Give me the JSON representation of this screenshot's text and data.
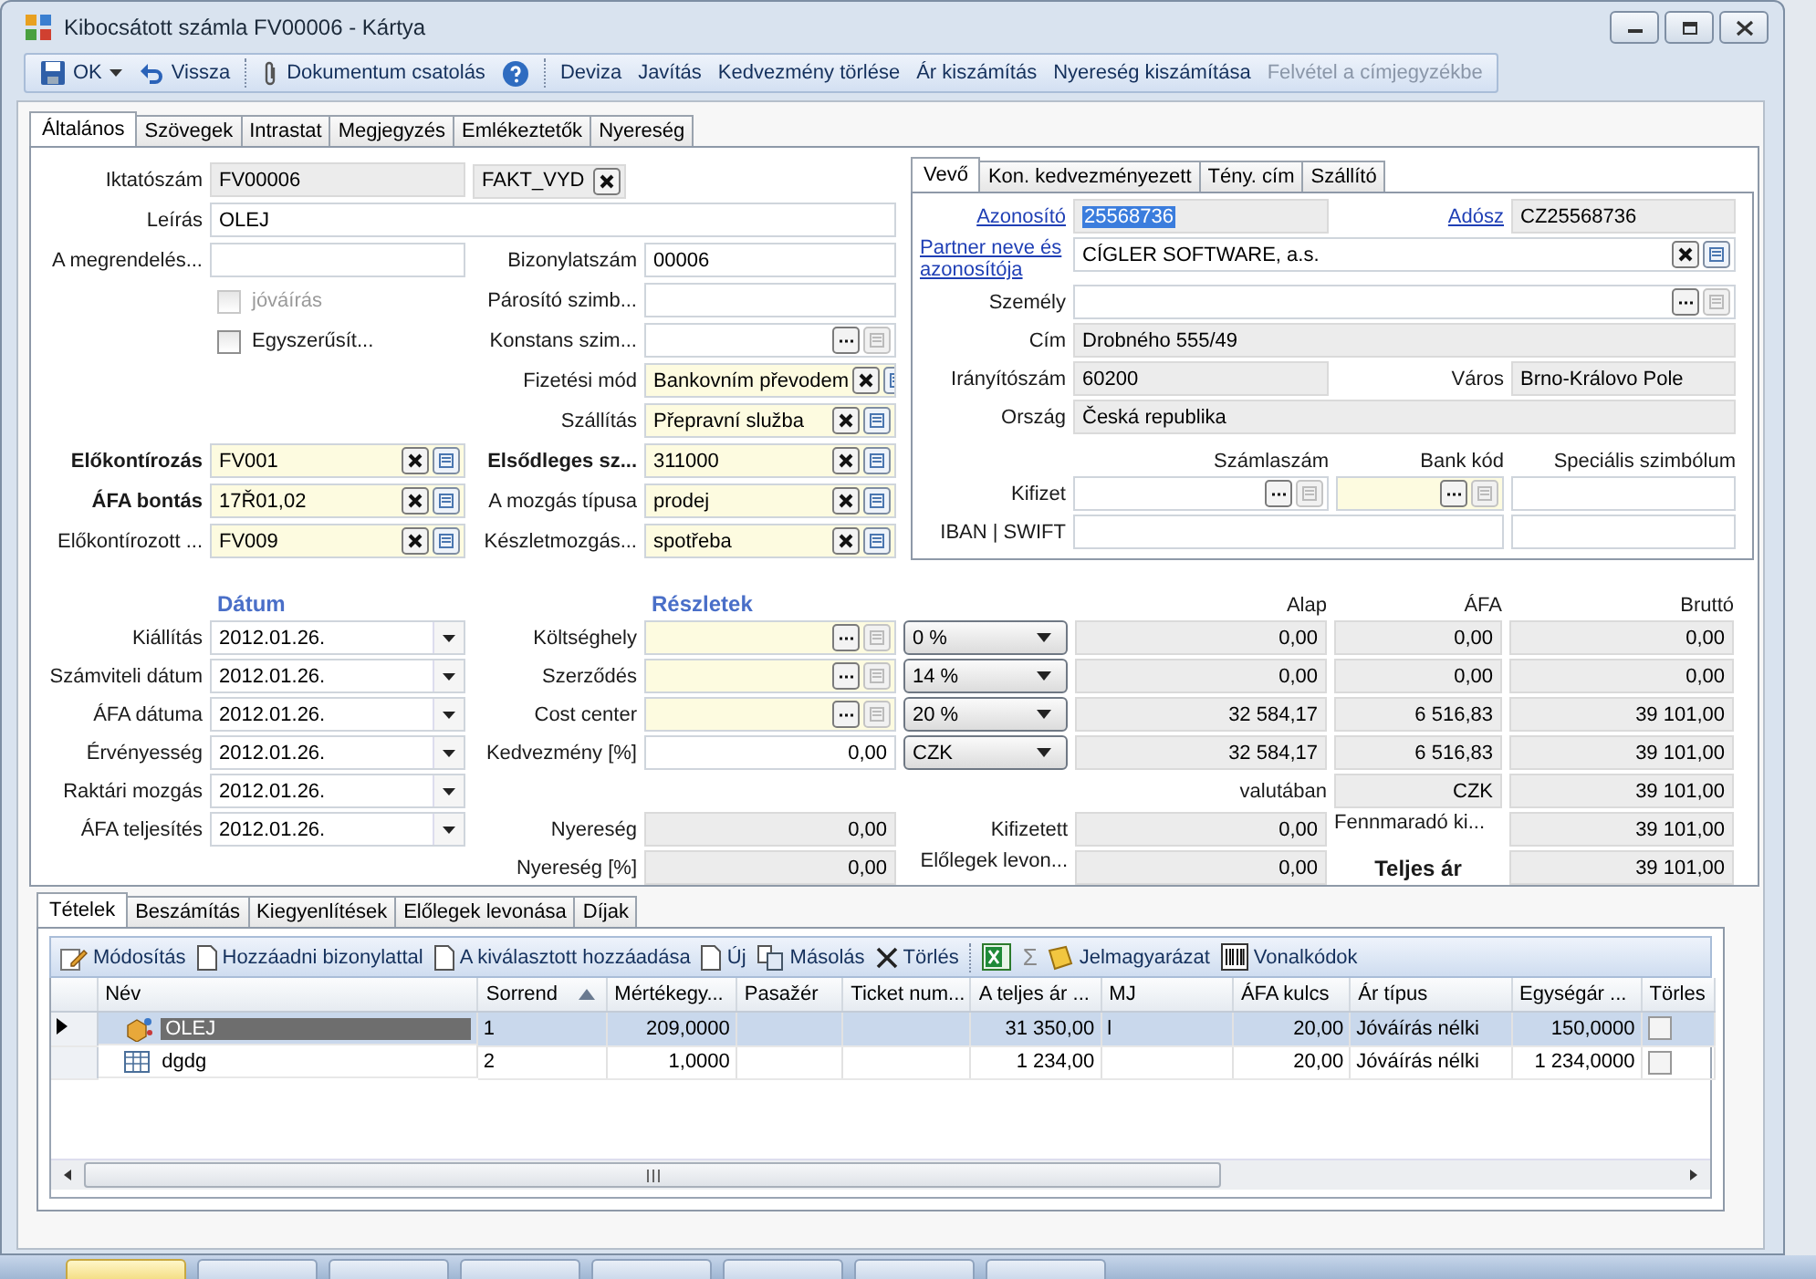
{
  "window": {
    "title": "Kibocsátott számla FV00006 - Kártya"
  },
  "toolbar": [
    {
      "label": "OK",
      "kind": "save",
      "disabled": false
    },
    {
      "label": "Vissza",
      "kind": "undo",
      "disabled": false
    },
    {
      "kind": "separator"
    },
    {
      "label": "Dokumentum csatolás",
      "kind": "attach",
      "disabled": false
    },
    {
      "kind": "help"
    },
    {
      "kind": "separator"
    },
    {
      "label": "Deviza",
      "kind": "text",
      "disabled": false
    },
    {
      "label": "Javítás",
      "kind": "text",
      "disabled": false
    },
    {
      "label": "Kedvezmény törlése",
      "kind": "text",
      "disabled": false
    },
    {
      "label": "Ár kiszámítás",
      "kind": "text",
      "disabled": false
    },
    {
      "label": "Nyereség kiszámítása",
      "kind": "text",
      "disabled": false
    },
    {
      "label": "Felvétel a címjegyzékbe",
      "kind": "text",
      "disabled": true
    }
  ],
  "tabs": [
    {
      "label": "Általános",
      "selected": true
    },
    {
      "label": "Szövegek",
      "selected": false
    },
    {
      "label": "Intrastat",
      "selected": false
    },
    {
      "label": "Megjegyzés",
      "selected": false
    },
    {
      "label": "Emlékeztetők",
      "selected": false
    },
    {
      "label": "Nyereség",
      "selected": false
    }
  ],
  "general": {
    "rows": [
      {
        "kind": "split",
        "label": "Iktatószám",
        "bold": false,
        "fields": [
          {
            "kind": "readonly",
            "value": "FV00006"
          },
          {
            "kind": "code",
            "value": "FAKT_VYD"
          }
        ]
      },
      {
        "kind": "wide",
        "label": "Leírás",
        "bold": false,
        "fields": [
          {
            "kind": "text",
            "value": "OLEJ",
            "required": false
          }
        ]
      },
      {
        "kind": "pair",
        "label": "A megrendelés...",
        "bold": false,
        "fields": [
          {
            "kind": "text",
            "required": false
          }
        ],
        "right": {
          "label": "Bizonylatszám",
          "bold": false,
          "field": {
            "kind": "text",
            "value": "00006",
            "required": false
          }
        }
      },
      {
        "kind": "pair",
        "fields": [
          {
            "kind": "checkbox",
            "label": "jóváírás",
            "checked": false,
            "disabled": true
          }
        ],
        "right": {
          "label": "Párosító szimb...",
          "bold": false,
          "field": {
            "kind": "text",
            "required": false
          }
        }
      },
      {
        "kind": "pair",
        "fields": [
          {
            "kind": "checkbox",
            "label": "Egyszerűsít...",
            "checked": false,
            "disabled": false
          }
        ],
        "right": {
          "label": "Konstans szim...",
          "bold": false,
          "field": {
            "kind": "picker",
            "required": false
          }
        }
      },
      {
        "kind": "pair",
        "right": {
          "label": "Fizetési mód",
          "bold": false,
          "field": {
            "kind": "lookup",
            "value": "Bankovním převodem",
            "required": true
          }
        }
      },
      {
        "kind": "pair",
        "right": {
          "label": "Szállítás",
          "bold": false,
          "field": {
            "kind": "lookup",
            "value": "Přepravní služba",
            "required": true
          }
        }
      },
      {
        "kind": "pair",
        "label": "Előkontírozás",
        "bold": true,
        "fields": [
          {
            "kind": "lookup",
            "value": "FV001",
            "required": true
          }
        ],
        "right": {
          "label": "Elsődleges sz...",
          "bold": true,
          "field": {
            "kind": "lookup",
            "value": "311000",
            "required": true
          }
        }
      },
      {
        "kind": "pair",
        "label": "ÁFA bontás",
        "bold": true,
        "fields": [
          {
            "kind": "lookup",
            "value": "17Ř01,02",
            "required": true
          }
        ],
        "right": {
          "label": "A mozgás típusa",
          "bold": false,
          "field": {
            "kind": "lookup",
            "value": "prodej",
            "required": true
          }
        }
      },
      {
        "kind": "pair",
        "label": "Előkontírozott ...",
        "bold": false,
        "fields": [
          {
            "kind": "lookup",
            "value": "FV009",
            "required": true
          }
        ],
        "right": {
          "label": "Készletmozgás...",
          "bold": false,
          "field": {
            "kind": "lookup",
            "value": "spotřeba",
            "required": true
          }
        }
      }
    ]
  },
  "partner": {
    "tabs": [
      {
        "label": "Vevő",
        "selected": true
      },
      {
        "label": "Kon. kedvezményezett",
        "selected": false
      },
      {
        "label": "Tény. cím",
        "selected": false
      },
      {
        "label": "Szállító",
        "selected": false
      }
    ],
    "rows": [
      {
        "kind": "pair",
        "label": "Azonosító",
        "link": true,
        "fields": [
          {
            "kind": "readonly",
            "value": "25568736",
            "highlighted": true
          }
        ],
        "right": {
          "label": "Adósz",
          "link": true,
          "field": {
            "kind": "readonly",
            "value": "CZ25568736",
            "highlighted": false
          }
        }
      },
      {
        "kind": "wide",
        "label": "Partner neve és azonosítója",
        "link": true,
        "fields": [
          {
            "kind": "lookup",
            "value": "CÍGLER SOFTWARE, a.s.",
            "required": false
          }
        ]
      },
      {
        "kind": "wide",
        "label": "Személy",
        "link": false,
        "fields": [
          {
            "kind": "picker",
            "required": false
          }
        ]
      },
      {
        "kind": "wide",
        "label": "Cím",
        "link": false,
        "fields": [
          {
            "kind": "readonly",
            "value": "Drobného 555/49"
          }
        ]
      },
      {
        "kind": "pair",
        "label": "Irányítószám",
        "link": false,
        "fields": [
          {
            "kind": "readonly",
            "value": "60200"
          }
        ],
        "right": {
          "label": "Város",
          "link": false,
          "field": {
            "kind": "readonly",
            "value": "Brno-Královo Pole"
          }
        }
      },
      {
        "kind": "wide",
        "label": "Ország",
        "link": false,
        "fields": [
          {
            "kind": "readonly",
            "value": "Česká republika"
          }
        ]
      },
      {
        "kind": "headers",
        "headers": [
          "Számlaszám",
          "Bank kód",
          "Speciális szimbólum"
        ]
      },
      {
        "kind": "triple",
        "label": "Kifizet",
        "link": false,
        "fields": [
          {
            "kind": "picker",
            "required": false
          },
          {
            "kind": "picker",
            "required": true
          },
          {
            "kind": "text",
            "required": false
          }
        ]
      },
      {
        "kind": "double",
        "label": "IBAN | SWIFT",
        "link": false,
        "fields": [
          {
            "kind": "text",
            "required": false
          },
          {
            "kind": "text",
            "required": false
          }
        ]
      }
    ]
  },
  "dates": {
    "header": "Dátum",
    "rows": [
      {
        "label": "Kiállítás",
        "value": "2012.01.26."
      },
      {
        "label": "Számviteli dátum",
        "value": "2012.01.26."
      },
      {
        "label": "ÁFA dátuma",
        "value": "2012.01.26."
      },
      {
        "label": "Érvényesség",
        "value": "2012.01.26."
      },
      {
        "label": "Raktári mozgás",
        "value": "2012.01.26."
      },
      {
        "label": "ÁFA teljesítés",
        "value": "2012.01.26."
      }
    ]
  },
  "details": {
    "header": "Részletek",
    "rows": [
      {
        "label": "Költséghely",
        "field": {
          "kind": "picker",
          "required": true
        }
      },
      {
        "label": "Szerződés",
        "field": {
          "kind": "picker",
          "required": true
        }
      },
      {
        "label": "Cost center",
        "field": {
          "kind": "picker",
          "required": true
        }
      },
      {
        "label": "Kedvezmény [%]",
        "field": {
          "kind": "number",
          "value": "0,00",
          "required": false
        }
      },
      {
        "label": "Nyereség",
        "field": {
          "kind": "readonly-number",
          "value": "0,00"
        }
      },
      {
        "label": "Nyereség [%]",
        "field": {
          "kind": "readonly-number",
          "value": "0,00"
        }
      }
    ]
  },
  "vat": {
    "columns": [
      "Alap",
      "ÁFA",
      "Bruttó"
    ],
    "rates": [
      {
        "rate": "0 %",
        "values": [
          "0,00",
          "0,00",
          "0,00"
        ]
      },
      {
        "rate": "14 %",
        "values": [
          "0,00",
          "0,00",
          "0,00"
        ]
      },
      {
        "rate": "20 %",
        "values": [
          "32 584,17",
          "6 516,83",
          "39 101,00"
        ]
      }
    ],
    "currency": {
      "code": "CZK",
      "values": [
        "32 584,17",
        "6 516,83",
        "39 101,00"
      ]
    },
    "foreign": {
      "label": "valutában",
      "currency": "CZK",
      "total": "39 101,00"
    },
    "paid": {
      "label": "Kifizetett",
      "value": "0,00",
      "remaining_label": "Fennmaradó ki...",
      "remaining": "39 101,00"
    },
    "advances": {
      "label": "Előlegek levon...",
      "value": "0,00",
      "total_label": "Teljes ár",
      "total": "39 101,00"
    }
  },
  "items": {
    "tabs": [
      {
        "label": "Tételek",
        "selected": true
      },
      {
        "label": "Beszámítás",
        "selected": false
      },
      {
        "label": "Kiegyenlítések",
        "selected": false
      },
      {
        "label": "Előlegek levonása",
        "selected": false
      },
      {
        "label": "Díjak",
        "selected": false
      }
    ],
    "toolbar": [
      {
        "label": "Módosítás",
        "kind": "edit"
      },
      {
        "label": "Hozzáadni bizonylattal",
        "kind": "page"
      },
      {
        "label": "A kiválasztott hozzáadása",
        "kind": "page"
      },
      {
        "label": "Új",
        "kind": "page"
      },
      {
        "label": "Másolás",
        "kind": "copy"
      },
      {
        "label": "Törlés",
        "kind": "delete"
      },
      {
        "kind": "separator"
      },
      {
        "kind": "excel"
      },
      {
        "label": "Σ",
        "kind": "sum"
      },
      {
        "label": "Jelmagyarázat",
        "kind": "legend"
      },
      {
        "label": "Vonalkódok",
        "kind": "barcode"
      }
    ],
    "columns": [
      {
        "label": "Név",
        "sorted": false
      },
      {
        "label": "Sorrend",
        "sorted": true
      },
      {
        "label": "Mértékegy...",
        "sorted": false
      },
      {
        "label": "Pasažér",
        "sorted": false
      },
      {
        "label": "Ticket num...",
        "sorted": false
      },
      {
        "label": "A teljes ár ...",
        "sorted": false
      },
      {
        "label": "MJ",
        "sorted": false
      },
      {
        "label": "ÁFA kulcs",
        "sorted": false
      },
      {
        "label": "Ár típus",
        "sorted": false
      },
      {
        "label": "Egységár ...",
        "sorted": false
      },
      {
        "label": "Törles",
        "sorted": false
      }
    ],
    "rows": [
      {
        "selected": true,
        "kind": "product",
        "name": "OLEJ",
        "order": "1",
        "quantity": "209,0000",
        "total": "31 350,00",
        "unit": "l",
        "vat_rate": "20,00",
        "price_type": "Jóváírás nélki",
        "unit_price": "150,0000",
        "deleted": false
      },
      {
        "selected": false,
        "kind": "table",
        "name": "dgdg",
        "order": "2",
        "quantity": "1,0000",
        "total": "1 234,00",
        "vat_rate": "20,00",
        "price_type": "Jóváírás nélki",
        "unit_price": "1 234,0000",
        "deleted": false
      }
    ]
  }
}
